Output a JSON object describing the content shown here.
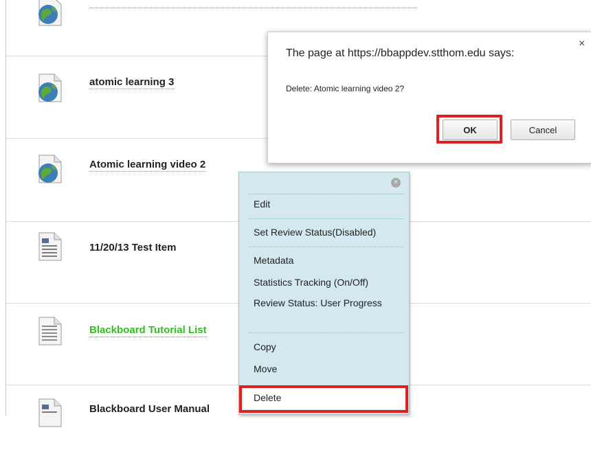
{
  "items": [
    {
      "title": "",
      "icon": "globe-document-icon"
    },
    {
      "title": "atomic learning 3",
      "icon": "globe-document-icon"
    },
    {
      "title": "Atomic learning video 2",
      "icon": "globe-document-icon"
    },
    {
      "title": "11/20/13 Test Item",
      "icon": "text-document-icon"
    },
    {
      "title": "Blackboard Tutorial List",
      "icon": "blank-document-icon",
      "color": "#2fbf1e"
    },
    {
      "title": "Blackboard User Manual",
      "icon": "text-document-icon"
    }
  ],
  "dialog": {
    "title": "The page at https://bbappdev.stthom.edu says:",
    "message": "Delete: Atomic learning video 2?",
    "ok_label": "OK",
    "cancel_label": "Cancel",
    "close_glyph": "×"
  },
  "context_menu": {
    "close_glyph": "×",
    "items": [
      "Edit",
      "Set Review Status(Disabled)",
      "Metadata",
      "Statistics Tracking (On/Off)",
      "Review Status: User Progress",
      "Copy",
      "Move",
      "Delete"
    ]
  },
  "colors": {
    "highlight": "#e02020",
    "menu_background": "#d3e8ef",
    "green_link": "#2fbf1e"
  }
}
